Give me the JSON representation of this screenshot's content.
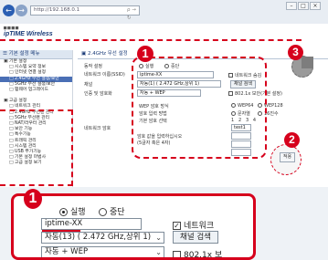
{
  "browser": {
    "url": "http://192.168.0.1",
    "address_icons": "ρ → ↻",
    "back_icon": "arrow-left-icon",
    "forward_icon": "arrow-right-icon"
  },
  "window": {
    "min": "–",
    "max": "□",
    "close": "×"
  },
  "brand": {
    "dots": "■■■■",
    "logo": "ipTIME Wireless"
  },
  "sidebar": {
    "header": "☰ 기본 설정 메뉴",
    "group1": [
      {
        "label": "▣ 기본 설정",
        "level": 0
      },
      {
        "label": "□ 시스템 요약 정보",
        "level": 1
      },
      {
        "label": "□ 인터넷 연결 설정",
        "level": 1
      },
      {
        "label": "□ 2.4GHz 무선 설정/보안",
        "level": 1,
        "selected": true
      },
      {
        "label": "□ 5GHz 무선 설정/보안",
        "level": 1
      },
      {
        "label": "□ 펌웨어 업그레이드",
        "level": 1
      }
    ],
    "group2": [
      {
        "label": "▣ 고급 설정",
        "level": 0
      },
      {
        "label": "□ 네트워크 관리",
        "level": 1
      },
      {
        "label": "□ 2.4GHz 무선랜 관리",
        "level": 1
      },
      {
        "label": "□ 5GHz 무선랜 관리",
        "level": 1
      },
      {
        "label": "□ NAT/라우터 관리",
        "level": 1
      },
      {
        "label": "□ 보안 기능",
        "level": 1
      },
      {
        "label": "□ 특수기능",
        "level": 1
      },
      {
        "label": "□ 트래픽 관리",
        "level": 1
      },
      {
        "label": "□ 시스템 관리",
        "level": 1
      },
      {
        "label": "□ USB 부가기능",
        "level": 1
      },
      {
        "label": "□ 기본 설정 마법사",
        "level": 1
      },
      {
        "label": "□ 고급 설정 보기",
        "level": 1
      }
    ]
  },
  "main": {
    "title": "▣ 2.4GHz 무선 설정",
    "labels": {
      "operation": "동작 설정",
      "ssid": "네트워크 이름(SSID)",
      "channel": "채널",
      "auth": "인증 및 암호화",
      "security": "네트워크 암호"
    },
    "mini": {
      "run": "실행",
      "stop": "중단",
      "ssid_value": "iptime-XX",
      "hide_ssid": "네트워크 숨김",
      "channel_value": "자동(1) ( 2.472 GHz,상위 1)",
      "channel_search": "채널 검색",
      "auth_value": "자동 + WEP",
      "dot1x": "802.1x 보안(기본 설정)",
      "wep_type_label": "WEP 암호 방식",
      "wep64": "WEP64",
      "wep128": "WEP128",
      "key_input_label": "암호 입력 방법",
      "ascii": "문자열",
      "hex": "16진수",
      "default_key_label": "기본 암호 선택",
      "keys": [
        "1",
        "2",
        "3",
        "4"
      ],
      "key1_value": "test1",
      "key_hint1": "암호 값을 입력하십시오",
      "key_hint2": "(5글자 혹은 4자)"
    },
    "apply": "적용"
  },
  "callouts": {
    "one": "1",
    "two": "2",
    "three": "3"
  },
  "zoom": {
    "run": "실행",
    "stop": "중단",
    "ssid_value": "iptime-XX",
    "hide_ssid": "네트워크",
    "channel_value": "자동(13) ( 2.472 GHz,상위 1)",
    "channel_search": "채널 검색",
    "auth_value": "자동 + WEP",
    "dot1x": "802.1x 보"
  },
  "colors": {
    "accent": "#d6001c",
    "nav": "#2b5fb3",
    "selected": "#4a6fb5"
  }
}
